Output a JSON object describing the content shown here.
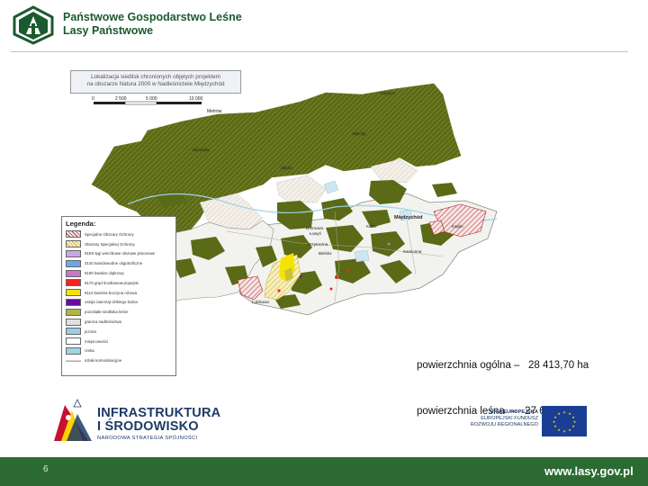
{
  "header": {
    "logo_text": "LASY PAŃSTWOWE",
    "title_line1": "Państwowe Gospodarstwo Leśne",
    "title_line2": "Lasy Państwowe"
  },
  "map": {
    "title_line1": "Lokalizacja siedlisk chronionych objętych projektem",
    "title_line2": "na obszarze Natura 2000 w Nadleśnictwie Międzychód",
    "scale_ticks": [
      "0",
      "2 500",
      "5 000",
      "10 000"
    ],
    "scale_unit": "Metrów",
    "place_labels": [
      "Międzychód",
      "Gorzyce",
      "Mnichy",
      "Sieraków",
      "Zatom",
      "Lubikowo",
      "Przytoczna",
      "Kamionna",
      "Kolno",
      "Bielsko",
      "Dormowo",
      "Łowyń",
      "Kaplin"
    ],
    "colors": {
      "forest": "#5a6a16",
      "forest_hatch": "#8a9435",
      "land": "#f2f2ee",
      "water": "#cfe6f0",
      "border": "#8a8a8a"
    }
  },
  "legend": {
    "title": "Legenda:",
    "items": [
      {
        "label": "Specjalne Obszary Ochrony",
        "swatch": "hatch-red"
      },
      {
        "label": "Obszary Specjalnej Ochrony",
        "swatch": "hatch-yellow"
      },
      {
        "label": "91E0 łęgi wierzbowe olszowe jesionowe",
        "swatch": "#c8a7e3"
      },
      {
        "label": "3140 twardowodne oligotroficzne",
        "swatch": "#6aa8e8"
      },
      {
        "label": "9190 kwaśne dąbrowy",
        "swatch": "#c977c9"
      },
      {
        "label": "9170 grąd środkowoeuropejski",
        "swatch": "#ff2020"
      },
      {
        "label": "9110 kwaśna buczyna niżowa",
        "swatch": "#f5e400"
      },
      {
        "label": "ostoja zwierząt dzikiego bobra",
        "swatch": "#6a0aa0"
      },
      {
        "label": "pozostałe siedliska leśne",
        "swatch": "#b0b44a"
      },
      {
        "label": "granica nadleśnictwa",
        "swatch": "#e0e0e0"
      },
      {
        "label": "jeziora",
        "swatch": "#9ccce8"
      },
      {
        "label": "miejscowości",
        "swatch": "#ffffff"
      },
      {
        "label": "rzeka",
        "swatch": "#9fd3ea"
      },
      {
        "label": "szlaki komunikacyjne",
        "swatch": "line"
      }
    ]
  },
  "stats": {
    "line1": "powierzchnia ogólna –   28 413,70 ha",
    "line2": "powierzchnia leśna  –   27 619,59 ha"
  },
  "logos": {
    "infra_line1": "INFRASTRUKTURA",
    "infra_line2": "I ŚRODOWISKO",
    "infra_line3": "NARODOWA STRATEGIA SPÓJNOŚCI",
    "eu_line1": "UNIA EUROPEJSKA",
    "eu_line2": "EUROPEJSKI FUNDUSZ",
    "eu_line3": "ROZWOJU REGIONALNEGO"
  },
  "footer": {
    "page_number": "6",
    "url": "www.lasy.gov.pl"
  }
}
